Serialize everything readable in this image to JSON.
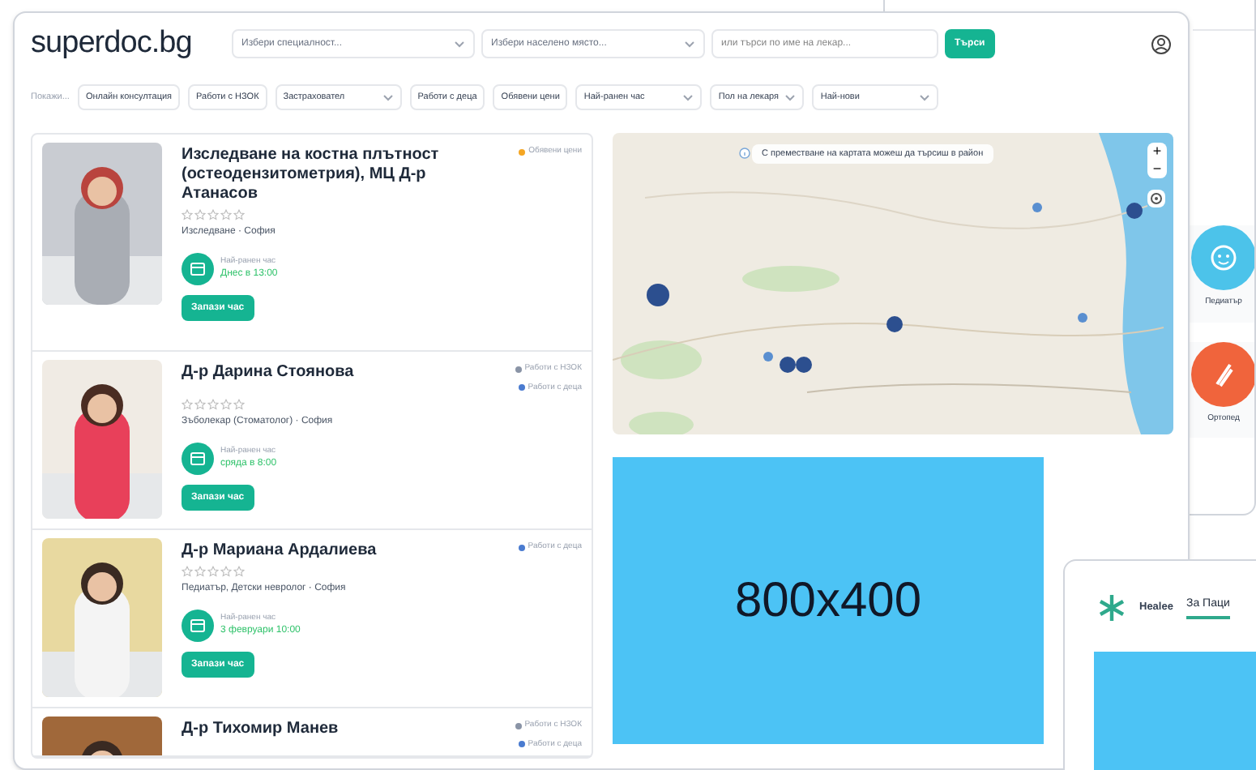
{
  "main_window": {
    "logo": "superdoc.bg",
    "specialty_select": {
      "placeholder": "Избери специалност..."
    },
    "city_select": {
      "placeholder": "Избери населено място..."
    },
    "search": {
      "placeholder": "или търси по име на лекар..."
    },
    "search_button": "Търси",
    "filters_label": "Покажи...",
    "filters": [
      {
        "kind": "toggle",
        "label": "Онлайн консултация"
      },
      {
        "kind": "toggle",
        "label": "Работи с НЗОК"
      },
      {
        "kind": "dropdown",
        "label": "Застраховател"
      },
      {
        "kind": "toggle",
        "label": "Работи с деца"
      },
      {
        "kind": "toggle",
        "label": "Обявени цени"
      },
      {
        "kind": "dropdown",
        "label": "Най-ранен час"
      },
      {
        "kind": "dropdown",
        "label": "Пол на лекаря"
      },
      {
        "kind": "dropdown",
        "label": "Най-нови"
      }
    ],
    "results": [
      {
        "title": "Изследване на костна плътност (остеодензитометрия), МЦ Д-р Атанасов",
        "stars": 0,
        "subtitle": "Изследване · София",
        "badges": [
          {
            "kind": "prices",
            "label": "Обявени цени"
          }
        ],
        "earliest_label": "Най-ранен час",
        "earliest": "Днес в 13:00",
        "button": "Запази час"
      },
      {
        "title": "Д-р Дарина Стоянова",
        "stars": 0,
        "subtitle": "Зъболекар (Стоматолог) · София",
        "badges": [
          {
            "kind": "nzok",
            "label": "Работи с НЗОК"
          },
          {
            "kind": "kids",
            "label": "Работи с деца"
          }
        ],
        "earliest_label": "Най-ранен час",
        "earliest": "сряда в 8:00",
        "button": "Запази час"
      },
      {
        "title": "Д-р Мариана Ардалиева",
        "stars": 0,
        "subtitle": "Педиатър, Детски невролог · София",
        "badges": [
          {
            "kind": "kids",
            "label": "Работи с деца"
          }
        ],
        "earliest_label": "Най-ранен час",
        "earliest": "3 февруари 10:00",
        "button": "Запази час"
      },
      {
        "title": "Д-р Тихомир Манев",
        "badges": [
          {
            "kind": "nzok",
            "label": "Работи с НЗОК"
          },
          {
            "kind": "kids",
            "label": "Работи с деца"
          }
        ]
      }
    ],
    "map": {
      "hint": "С преместване на картата можеш да търсиш в район",
      "zoom_in": "+",
      "zoom_out": "−"
    },
    "placeholder_image": "800x400"
  },
  "back_window": {
    "categories": [
      {
        "kind": "baby",
        "label": "Педиатър",
        "color": "#4cc3ea"
      },
      {
        "kind": "bone",
        "label": "Ортопед",
        "color": "#f0643c"
      }
    ]
  },
  "front_window": {
    "logo": "Healee",
    "tabs": [
      {
        "label": "За Паци",
        "selected": true
      }
    ]
  }
}
